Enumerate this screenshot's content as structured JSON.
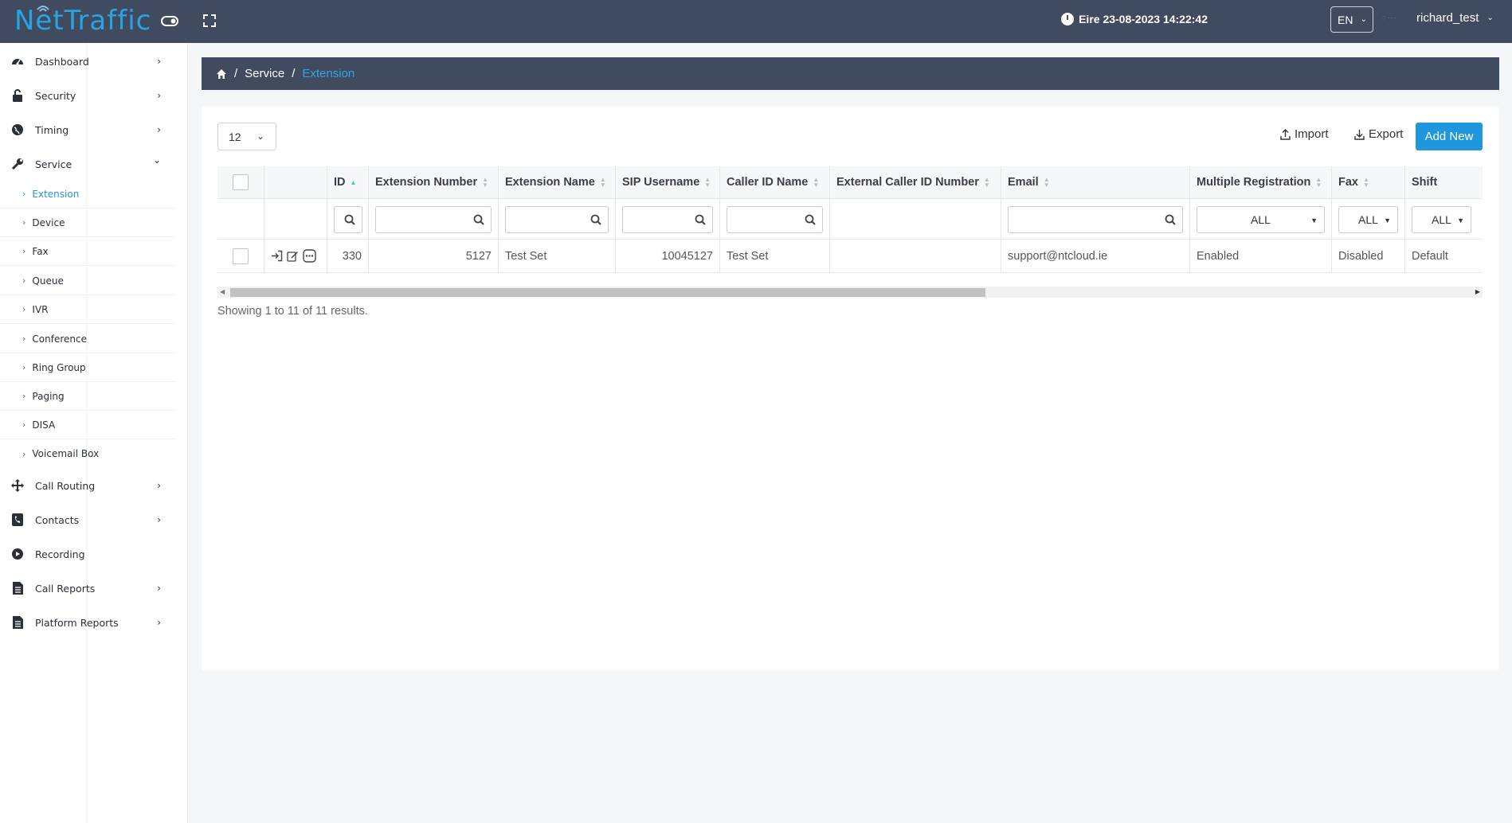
{
  "header": {
    "logo_text": "NetTraffic",
    "datetime": "Eire 23-08-2023 14:22:42",
    "language": "EN",
    "username": "richard_test"
  },
  "sidebar": {
    "items": [
      {
        "label": "Dashboard",
        "icon": "dashboard-icon",
        "arrow": "›"
      },
      {
        "label": "Security",
        "icon": "lock-icon",
        "arrow": "›"
      },
      {
        "label": "Timing",
        "icon": "globe-icon",
        "arrow": "›"
      },
      {
        "label": "Service",
        "icon": "wrench-icon",
        "arrow": "⌄"
      }
    ],
    "subitems": [
      "Extension",
      "Device",
      "Fax",
      "Queue",
      "IVR",
      "Conference",
      "Ring Group",
      "Paging",
      "DISA",
      "Voicemail Box"
    ],
    "items_after": [
      {
        "label": "Call Routing",
        "icon": "arrows-icon",
        "arrow": "›"
      },
      {
        "label": "Contacts",
        "icon": "phone-book-icon",
        "arrow": "›"
      },
      {
        "label": "Recording",
        "icon": "play-circle-icon",
        "arrow": ""
      },
      {
        "label": "Call Reports",
        "icon": "report-icon",
        "arrow": "›"
      },
      {
        "label": "Platform Reports",
        "icon": "report-icon",
        "arrow": "›"
      }
    ]
  },
  "breadcrumb": {
    "items": [
      "Service",
      "Extension"
    ]
  },
  "toolbar": {
    "page_size": "12",
    "import_label": "Import",
    "export_label": "Export",
    "add_new_label": "Add New"
  },
  "table": {
    "columns": [
      "ID",
      "Extension Number",
      "Extension Name",
      "SIP Username",
      "Caller ID Name",
      "External Caller ID Number",
      "Email",
      "Multiple Registration",
      "Fax",
      "Shift"
    ],
    "filters": {
      "multiple_registration": "ALL",
      "fax": "ALL",
      "shift": "ALL"
    },
    "rows": [
      {
        "id": "330",
        "extension_number": "5127",
        "extension_name": "Test Set",
        "sip_username": "10045127",
        "caller_id_name": "Test Set",
        "external_caller_id": "",
        "email": "support@ntcloud.ie",
        "multiple_registration": "Enabled",
        "fax": "Disabled",
        "shift": "Default"
      }
    ]
  },
  "summary": "Showing 1 to 11 of 11 results.",
  "colors": {
    "topbar": "#404b5f",
    "accent": "#1f97dc",
    "active_link": "#2196d8"
  }
}
